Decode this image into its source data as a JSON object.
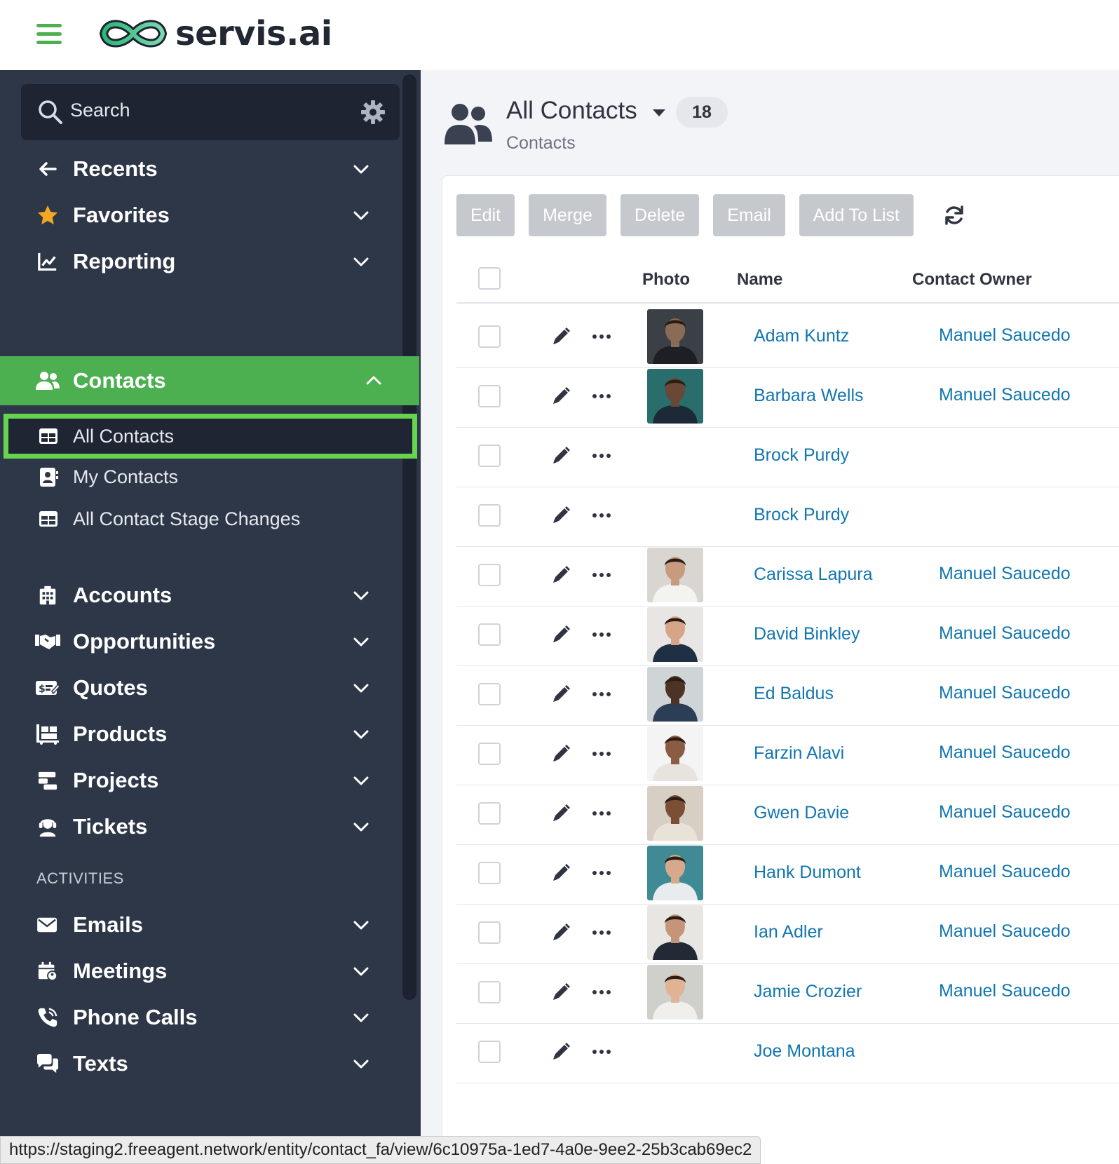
{
  "app": {
    "name": "servis.ai"
  },
  "sidebar": {
    "search_placeholder": "Search",
    "top_items": [
      {
        "label": "Recents",
        "icon": "arrow-left-icon"
      },
      {
        "label": "Favorites",
        "icon": "star-icon"
      },
      {
        "label": "Reporting",
        "icon": "chart-line-icon"
      }
    ],
    "contacts": {
      "label": "Contacts",
      "icon": "users-icon",
      "subitems": [
        {
          "label": "All Contacts",
          "icon": "table-icon"
        },
        {
          "label": "My Contacts",
          "icon": "address-card-icon"
        },
        {
          "label": "All Contact Stage Changes",
          "icon": "table-icon"
        }
      ]
    },
    "modules": [
      {
        "label": "Accounts",
        "icon": "building-icon"
      },
      {
        "label": "Opportunities",
        "icon": "handshake-icon"
      },
      {
        "label": "Quotes",
        "icon": "money-check-icon"
      },
      {
        "label": "Products",
        "icon": "pallet-icon"
      },
      {
        "label": "Projects",
        "icon": "project-icon"
      },
      {
        "label": "Tickets",
        "icon": "headset-icon"
      }
    ],
    "activities_heading": "ACTIVITIES",
    "activities": [
      {
        "label": "Emails",
        "icon": "envelope-icon"
      },
      {
        "label": "Meetings",
        "icon": "calendar-icon"
      },
      {
        "label": "Phone Calls",
        "icon": "phone-icon"
      },
      {
        "label": "Texts",
        "icon": "comments-icon"
      }
    ]
  },
  "main": {
    "title": "All Contacts",
    "count": "18",
    "subtitle": "Contacts",
    "toolbar": {
      "edit": "Edit",
      "merge": "Merge",
      "delete": "Delete",
      "email": "Email",
      "add_to_list": "Add To List"
    },
    "columns": {
      "photo": "Photo",
      "name": "Name",
      "owner": "Contact Owner"
    },
    "rows": [
      {
        "name": "Adam Kuntz",
        "owner": "Manuel Saucedo",
        "photo": true,
        "bg": "#3b3f46",
        "skin": "#8a6b55",
        "shirt": "#1d1f24"
      },
      {
        "name": "Barbara Wells",
        "owner": "Manuel Saucedo",
        "photo": true,
        "bg": "#2a6d6d",
        "skin": "#6a4736",
        "shirt": "#1b2a36"
      },
      {
        "name": "Brock Purdy",
        "owner": "",
        "photo": false
      },
      {
        "name": "Brock Purdy",
        "owner": "",
        "photo": false
      },
      {
        "name": "Carissa Lapura",
        "owner": "Manuel Saucedo",
        "photo": true,
        "bg": "#d9d6d2",
        "skin": "#c99b7e",
        "shirt": "#f3f3f0"
      },
      {
        "name": "David Binkley",
        "owner": "Manuel Saucedo",
        "photo": true,
        "bg": "#e8e6e4",
        "skin": "#d6a487",
        "shirt": "#1f2f44"
      },
      {
        "name": "Ed Baldus",
        "owner": "Manuel Saucedo",
        "photo": true,
        "bg": "#cfd4d6",
        "skin": "#4d3326",
        "shirt": "#2c3e55"
      },
      {
        "name": "Farzin Alavi",
        "owner": "Manuel Saucedo",
        "photo": true,
        "bg": "#f4f4f4",
        "skin": "#8a5c43",
        "shirt": "#e7e3df"
      },
      {
        "name": "Gwen Davie",
        "owner": "Manuel Saucedo",
        "photo": true,
        "bg": "#d8cfc4",
        "skin": "#7a4f36",
        "shirt": "#e9e2d8"
      },
      {
        "name": "Hank Dumont",
        "owner": "Manuel Saucedo",
        "photo": true,
        "bg": "#3f8a95",
        "skin": "#d7a98c",
        "shirt": "#e8ecef"
      },
      {
        "name": "Ian Adler",
        "owner": "Manuel Saucedo",
        "photo": true,
        "bg": "#e7e6e3",
        "skin": "#c69478",
        "shirt": "#222a35"
      },
      {
        "name": "Jamie Crozier",
        "owner": "Manuel Saucedo",
        "photo": true,
        "bg": "#cfd0cc",
        "skin": "#e0b394",
        "shirt": "#f0efec"
      },
      {
        "name": "Joe Montana",
        "owner": "",
        "photo": false
      }
    ]
  },
  "status_url": "https://staging2.freeagent.network/entity/contact_fa/view/6c10975a-1ed7-4a0e-9ee2-25b3cab69ec2",
  "colors": {
    "brand_green": "#4caf50",
    "sidebar_bg": "#2e3748",
    "link_blue": "#1276b0",
    "selected_border": "#66d44f"
  }
}
